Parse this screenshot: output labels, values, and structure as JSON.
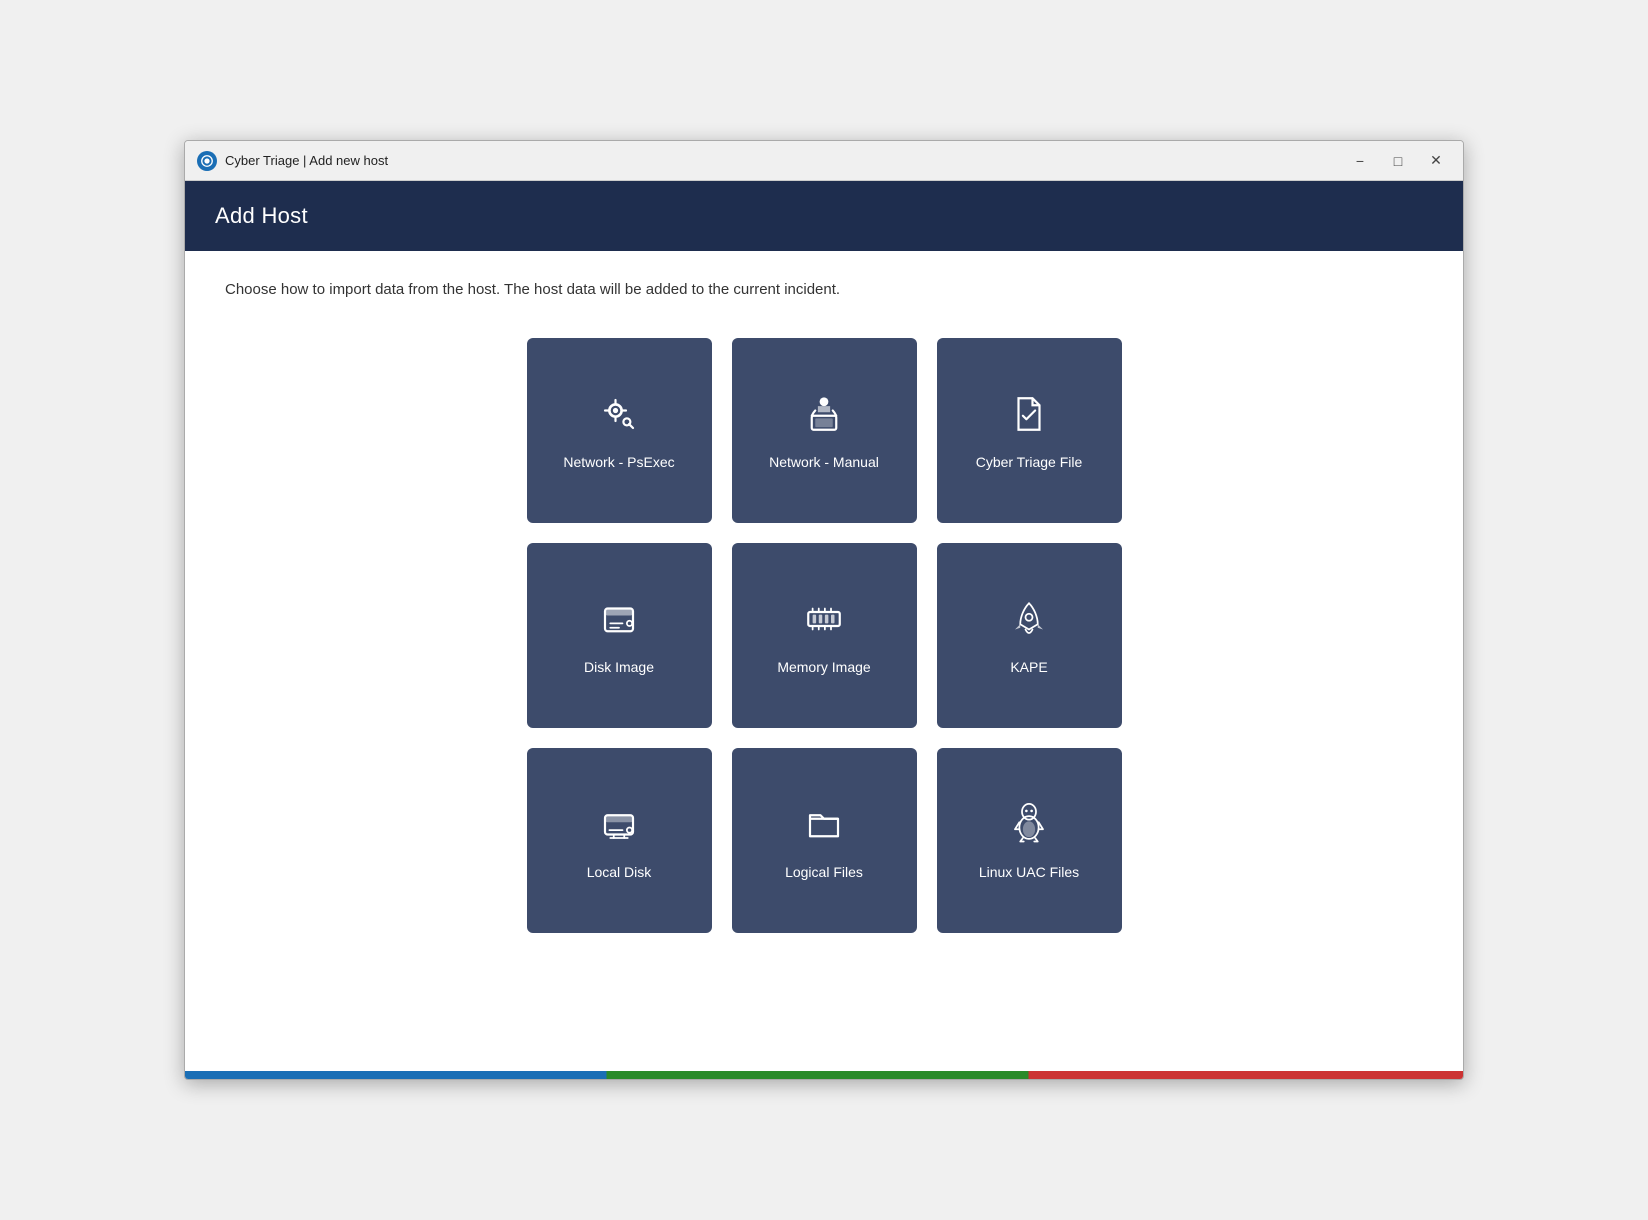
{
  "window": {
    "title": "Cyber Triage | Add new host",
    "minimize_label": "−",
    "maximize_label": "□",
    "close_label": "✕"
  },
  "header": {
    "title": "Add Host"
  },
  "main": {
    "description": "Choose how to import data from the host. The host data will be added to the current incident.",
    "tiles": [
      {
        "id": "network-psexec",
        "label": "Network - PsExec",
        "icon_name": "gear-network-icon"
      },
      {
        "id": "network-manual",
        "label": "Network - Manual",
        "icon_name": "person-laptop-icon"
      },
      {
        "id": "cyber-triage-file",
        "label": "Cyber Triage File",
        "icon_name": "document-check-icon"
      },
      {
        "id": "disk-image",
        "label": "Disk Image",
        "icon_name": "disk-icon"
      },
      {
        "id": "memory-image",
        "label": "Memory Image",
        "icon_name": "ram-icon"
      },
      {
        "id": "kape",
        "label": "KAPE",
        "icon_name": "rocket-icon"
      },
      {
        "id": "local-disk",
        "label": "Local Disk",
        "icon_name": "local-disk-icon"
      },
      {
        "id": "logical-files",
        "label": "Logical Files",
        "icon_name": "folder-icon"
      },
      {
        "id": "linux-uac-files",
        "label": "Linux UAC Files",
        "icon_name": "linux-icon"
      }
    ]
  }
}
